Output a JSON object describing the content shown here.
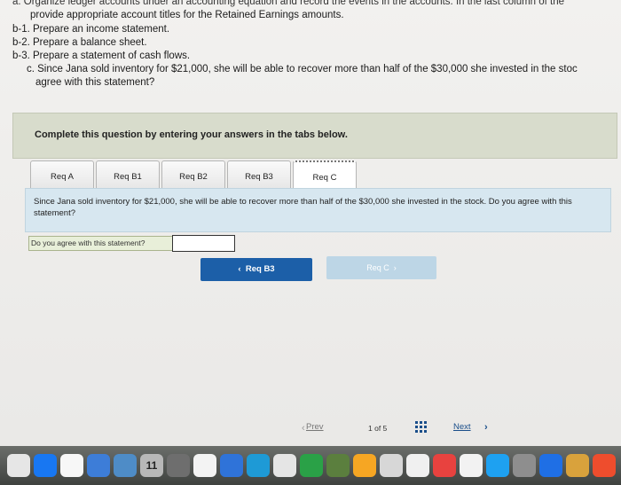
{
  "question": {
    "line0": "a. Organize ledger accounts under an accounting equation and record the events in the accounts. In the last column of the",
    "line1": "provide appropriate account titles for the Retained Earnings amounts.",
    "line2": "b-1. Prepare an income statement.",
    "line3": "b-2. Prepare a balance sheet.",
    "line4": "b-3. Prepare a statement of cash flows.",
    "line5": "c. Since Jana sold inventory for $21,000, she will be able to recover more than half of the $30,000 she invested in the stoc",
    "line6": "agree with this statement?"
  },
  "banner": "Complete this question by entering your answers in the tabs below.",
  "tabs": [
    {
      "label": "Req A"
    },
    {
      "label": "Req B1"
    },
    {
      "label": "Req B2"
    },
    {
      "label": "Req B3"
    },
    {
      "label": "Req C"
    }
  ],
  "active_tab": "Req C",
  "content": {
    "description": "Since Jana sold inventory for $21,000, she will be able to recover more than half of the $30,000 she invested in the stock. Do you agree with this statement?",
    "question_label": "Do you agree with this statement?",
    "answer_value": ""
  },
  "nav": {
    "prev_label": "Req B3",
    "next_label": "Req C"
  },
  "pager": {
    "prev": "Prev",
    "count": "1 of 5",
    "next": "Next"
  },
  "dock": {
    "calendar_day": "11",
    "colors": [
      "#e6e6e6",
      "#1877f2",
      "#f7f7f7",
      "#3d7dd8",
      "#4e8cc7",
      "#b8b8b8",
      "#6e6e6e",
      "#f3f3f3",
      "#2f73d9",
      "#1e9ad6",
      "#e5e5e5",
      "#2aa147",
      "#5b7f3e",
      "#f6a623",
      "#d7d7d7",
      "#f0f0f0",
      "#e8423f",
      "#f2f2f2",
      "#1ea1f1",
      "#8e8e8e",
      "#1f6fe5",
      "#d9a23c",
      "#ee4d2d"
    ]
  }
}
